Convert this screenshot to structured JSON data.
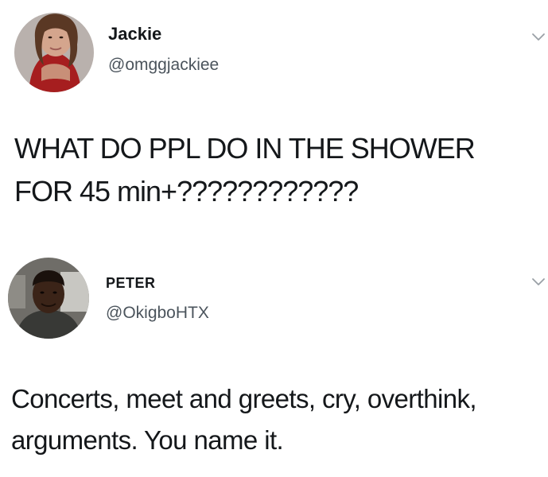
{
  "tweets": [
    {
      "display_name": "Jackie",
      "handle": "@omggjackiee",
      "text": "WHAT DO PPL DO IN THE SHOWER FOR 45 min+????????????",
      "avatar_icon": "profile-photo-woman"
    },
    {
      "display_name": "PETER",
      "handle": "@OkigboHTX",
      "text": "Concerts, meet and greets, cry, overthink, arguments. You name it.",
      "avatar_icon": "profile-photo-man"
    }
  ],
  "icons": {
    "more_menu": "chevron-down-icon"
  },
  "colors": {
    "text": "#14171a",
    "handle": "#4b545c",
    "background": "#ffffff"
  }
}
